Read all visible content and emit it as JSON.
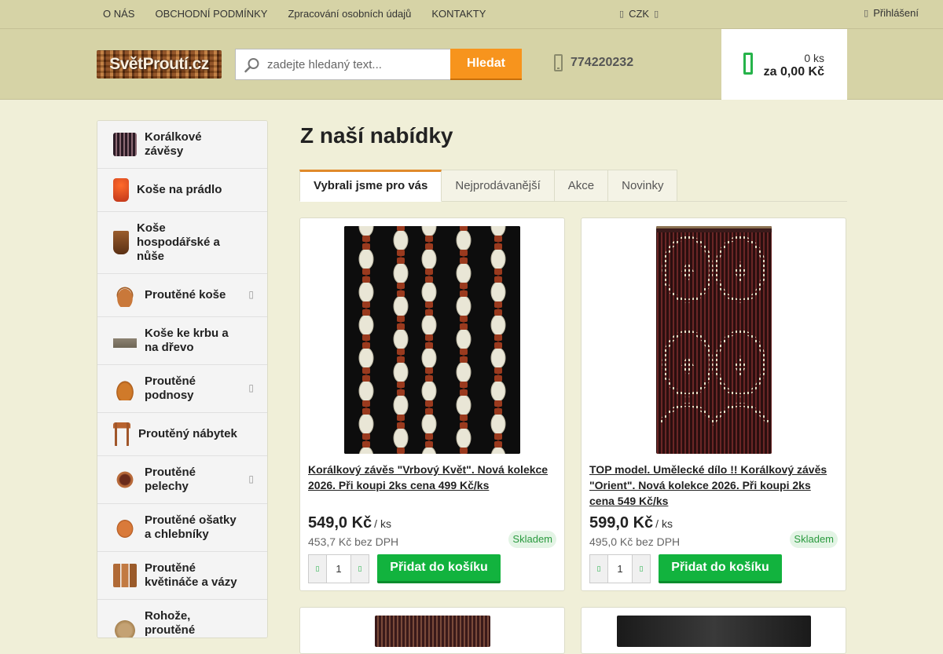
{
  "topbar": {
    "nav": [
      "O NÁS",
      "OBCHODNÍ PODMÍNKY",
      "Zpracování osobních údajů",
      "KONTAKTY"
    ],
    "currency": "CZK",
    "login": "Přihlášení"
  },
  "header": {
    "logo_text": "SvětProutí.cz",
    "search_placeholder": "zadejte hledaný text...",
    "search_button": "Hledat",
    "phone": "774220232",
    "cart_count": "0 ks",
    "cart_total": "za 0,00 Kč"
  },
  "sidebar": {
    "items": [
      {
        "label": "Korálkové závěsy",
        "has_children": false
      },
      {
        "label": "Koše na prádlo",
        "has_children": false
      },
      {
        "label": "Koše hospodářské a nůše",
        "has_children": false
      },
      {
        "label": "Proutěné koše",
        "has_children": true
      },
      {
        "label": "Koše ke krbu a na dřevo",
        "has_children": false
      },
      {
        "label": "Proutěné podnosy",
        "has_children": true
      },
      {
        "label": "Proutěný nábytek",
        "has_children": false
      },
      {
        "label": "Proutěné pelechy",
        "has_children": true
      },
      {
        "label": "Proutěné ošatky a chlebníky",
        "has_children": false
      },
      {
        "label": "Proutěné květináče a vázy",
        "has_children": false
      },
      {
        "label": "Rohože, proutěné",
        "has_children": false
      }
    ]
  },
  "main": {
    "heading": "Z naší nabídky",
    "tabs": [
      "Vybrali jsme pro vás",
      "Nejprodávanější",
      "Akce",
      "Novinky"
    ],
    "active_tab": 0,
    "products": [
      {
        "title": "Korálkový závěs \"Vrbový Květ\". Nová kolekce 2026. Při koupi 2ks cena 499 Kč/ks",
        "price": "549,0 Kč",
        "unit": "/ ks",
        "price_net": "453,7 Kč bez DPH",
        "stock": "Skladem",
        "qty": "1",
        "add_label": "Přidat do košíku"
      },
      {
        "title": "TOP model. Umělecké dílo !! Korálkový závěs \"Orient\". Nová kolekce 2026. Při koupi 2ks cena 549 Kč/ks",
        "price": "599,0 Kč",
        "unit": "/ ks",
        "price_net": "495,0 Kč bez DPH",
        "stock": "Skladem",
        "qty": "1",
        "add_label": "Přidat do košíku"
      }
    ]
  }
}
